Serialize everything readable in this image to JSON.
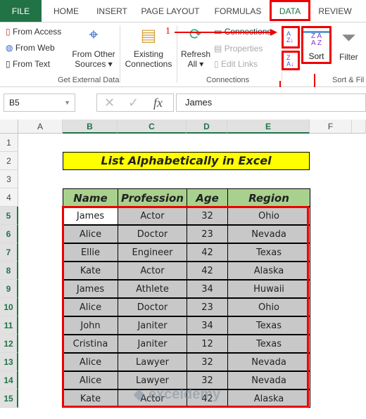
{
  "tabs": [
    "FILE",
    "HOME",
    "INSERT",
    "PAGE LAYOUT",
    "FORMULAS",
    "DATA",
    "REVIEW"
  ],
  "active_tab": "DATA",
  "ribbon": {
    "from_access": "From Access",
    "from_web": "From Web",
    "from_text": "From Text",
    "from_other": "From Other",
    "sources": "Sources ▾",
    "existing": "Existing",
    "connections_btn": "Connections",
    "refresh": "Refresh",
    "all": "All ▾",
    "connections": "Connections",
    "properties": "Properties",
    "edit_links": "Edit Links",
    "sort": "Sort",
    "filter": "Filter",
    "group_external": "Get External Data",
    "group_connections": "Connections",
    "group_sort": "Sort & Fil"
  },
  "annotations": [
    "1",
    "2",
    "3"
  ],
  "formula_bar": {
    "name_box": "B5",
    "value": "James",
    "fx": "fx"
  },
  "columns": [
    "A",
    "B",
    "C",
    "D",
    "E",
    "F"
  ],
  "rows": [
    "1",
    "2",
    "3",
    "4",
    "5",
    "6",
    "7",
    "8",
    "9",
    "10",
    "11",
    "12",
    "13",
    "14",
    "15"
  ],
  "sheet": {
    "title": "List Alphabetically in Excel",
    "headers": [
      "Name",
      "Profession",
      "Age",
      "Region"
    ],
    "data": [
      [
        "James",
        "Actor",
        "32",
        "Ohio"
      ],
      [
        "Alice",
        "Doctor",
        "23",
        "Nevada"
      ],
      [
        "Ellie",
        "Engineer",
        "42",
        "Texas"
      ],
      [
        "Kate",
        "Actor",
        "42",
        "Alaska"
      ],
      [
        "James",
        "Athlete",
        "34",
        "Huwaii"
      ],
      [
        "Alice",
        "Doctor",
        "23",
        "Ohio"
      ],
      [
        "John",
        "Janiter",
        "34",
        "Texas"
      ],
      [
        "Cristina",
        "Janiter",
        "12",
        "Texas"
      ],
      [
        "Alice",
        "Lawyer",
        "32",
        "Nevada"
      ],
      [
        "Alice",
        "Lawyer",
        "32",
        "Nevada"
      ],
      [
        "Kate",
        "Actor",
        "42",
        "Alaska"
      ]
    ]
  },
  "watermark": "exceldemy",
  "colors": {
    "excel_green": "#217346",
    "header_fill": "#a9d18e",
    "title_fill": "#ffff00",
    "annotation": "#ee0000"
  }
}
